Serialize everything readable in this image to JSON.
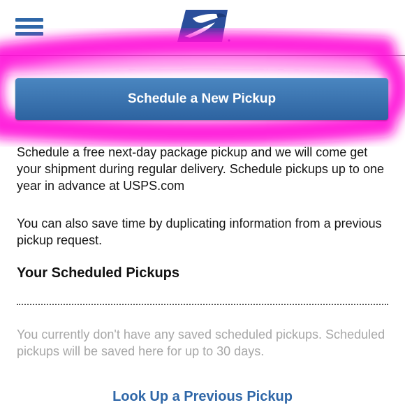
{
  "header": {
    "menu_icon": "hamburger-menu-icon",
    "logo_icon": "usps-eagle-logo-icon",
    "brand_color": "#2f67a8"
  },
  "main": {
    "schedule_button_label": "Schedule a New Pickup",
    "intro_text": "Schedule a free next-day package pickup and we will come get your shipment during regular delivery. Schedule pickups up to one year in advance at USPS.com",
    "save_time_text": "You can also save time by duplicating information from a previous pickup request.",
    "scheduled_section": {
      "title": "Your Scheduled Pickups",
      "empty_message": "You currently don't have any saved scheduled pickups. Scheduled pickups will be saved here for up to 30 days."
    },
    "lookup_link_label": "Look Up a Previous Pickup"
  },
  "colors": {
    "button_top": "#4a86c0",
    "button_bottom": "#2d63a0",
    "highlight": "#ff10d8",
    "muted_text": "#a7a7a7"
  }
}
